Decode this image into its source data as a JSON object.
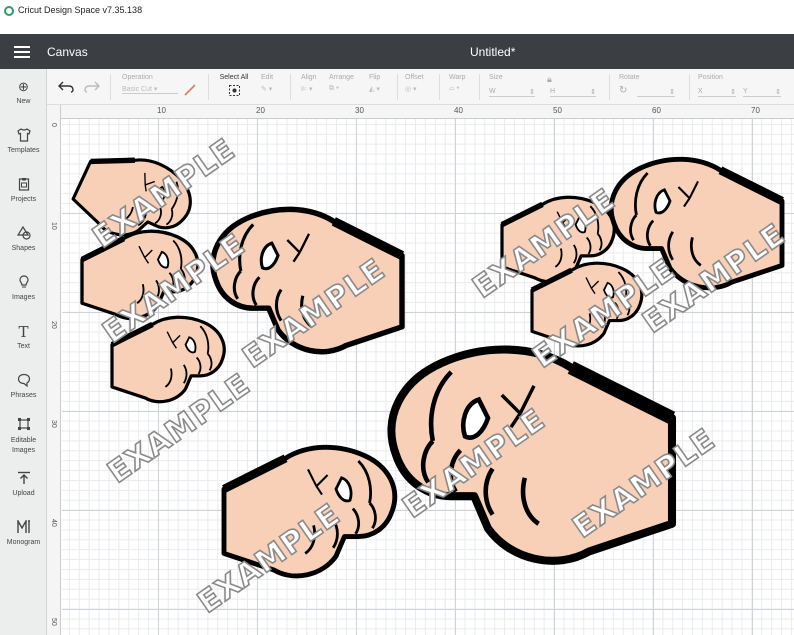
{
  "app": {
    "title": "Cricut Design Space  v7.35.138"
  },
  "appbar": {
    "section": "Canvas",
    "document_title": "Untitled*"
  },
  "sidebar": {
    "items": [
      {
        "label": "New",
        "icon": "plus-circle-icon"
      },
      {
        "label": "Templates",
        "icon": "shirt-icon"
      },
      {
        "label": "Projects",
        "icon": "clipboard-icon"
      },
      {
        "label": "Shapes",
        "icon": "shapes-icon"
      },
      {
        "label": "Images",
        "icon": "lightbulb-icon"
      },
      {
        "label": "Text",
        "icon": "text-icon"
      },
      {
        "label": "Phrases",
        "icon": "speech-bubble-icon"
      },
      {
        "label": "Editable Images",
        "icon": "editable-image-icon"
      },
      {
        "label": "Upload",
        "icon": "upload-icon"
      },
      {
        "label": "Monogram",
        "icon": "monogram-icon"
      }
    ]
  },
  "toolbar": {
    "operation_label": "Operation",
    "operation_value": "Basic Cut",
    "select_all": "Select All",
    "edit": "Edit",
    "align": "Align",
    "arrange": "Arrange",
    "flip": "Flip",
    "offset": "Offset",
    "warp": "Warp",
    "size": "Size",
    "w": "W",
    "h": "H",
    "rotate": "Rotate",
    "position": "Position",
    "x": "X",
    "y": "Y"
  },
  "ruler": {
    "top": [
      "10",
      "20",
      "30",
      "40",
      "50",
      "60",
      "70"
    ],
    "left": [
      "0",
      "10",
      "20",
      "30",
      "40",
      "50"
    ]
  },
  "watermark": "EXAMPLE",
  "colors": {
    "skin": "#f8d0b8",
    "outline": "#000000",
    "appbar": "#3b3e43"
  }
}
